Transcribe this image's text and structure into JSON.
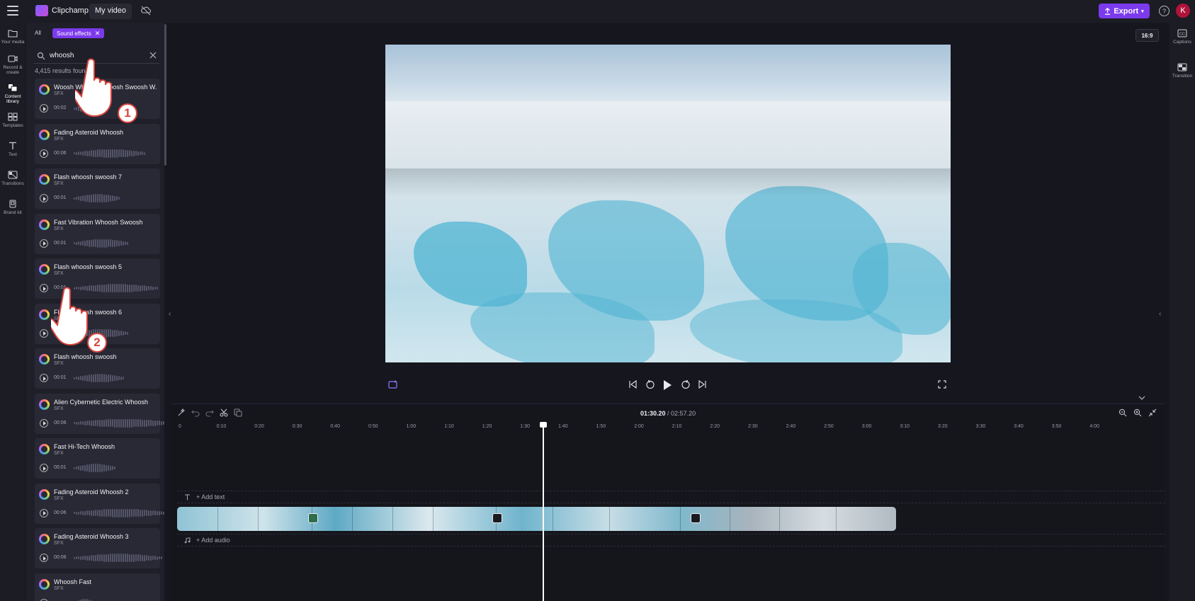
{
  "app": {
    "brand": "Clipchamp",
    "project_name": "My video",
    "export_label": "Export",
    "avatar_initial": "K",
    "accent_color": "#7c3aed"
  },
  "rail": {
    "items": [
      {
        "label": "Your media",
        "icon": "folder-icon"
      },
      {
        "label": "Record & create",
        "icon": "camera-icon"
      },
      {
        "label": "Content library",
        "icon": "library-icon"
      },
      {
        "label": "Templates",
        "icon": "templates-icon"
      },
      {
        "label": "Text",
        "icon": "text-icon"
      },
      {
        "label": "Transitions",
        "icon": "transitions-icon"
      },
      {
        "label": "Brand kit",
        "icon": "brand-kit-icon"
      }
    ]
  },
  "panel": {
    "filter_all": "All",
    "filter_active": "Sound effects",
    "search_value": "whoosh",
    "results_text": "4,415 results found",
    "items": [
      {
        "title": "Woosh Whoosh Swoosh Swoosh W...",
        "type": "SFX",
        "duration": "00:02"
      },
      {
        "title": "Fading Asteroid Whoosh",
        "type": "SFX",
        "duration": "00:06"
      },
      {
        "title": "Flash whoosh swoosh 7",
        "type": "SFX",
        "duration": "00:01"
      },
      {
        "title": "Fast Vibration Whoosh Swoosh",
        "type": "SFX",
        "duration": "00:01"
      },
      {
        "title": "Flash whoosh swoosh 5",
        "type": "SFX",
        "duration": "00:01"
      },
      {
        "title": "Flash whoosh swoosh 6",
        "type": "SFX",
        "duration": "00:01"
      },
      {
        "title": "Flash whoosh swoosh",
        "type": "SFX",
        "duration": "00:01"
      },
      {
        "title": "Alien Cybernetic Electric Whoosh",
        "type": "SFX",
        "duration": "00:06"
      },
      {
        "title": "Fast Hi-Tech Whoosh",
        "type": "SFX",
        "duration": "00:01"
      },
      {
        "title": "Fading Asteroid Whoosh 2",
        "type": "SFX",
        "duration": "00:06"
      },
      {
        "title": "Fading Asteroid Whoosh 3",
        "type": "SFX",
        "duration": "00:06"
      },
      {
        "title": "Whoosh Fast",
        "type": "SFX",
        "duration": ""
      }
    ]
  },
  "right_rail": {
    "captions_label": "Captions",
    "transition_label": "Transition"
  },
  "preview": {
    "aspect_ratio": "16:9"
  },
  "timeline": {
    "current_time": "01:30.20",
    "total_time": "02:57.20",
    "separator": " / ",
    "ruler": [
      "0",
      "0:10",
      "0:20",
      "0:30",
      "0:40",
      "0:50",
      "1:00",
      "1:10",
      "1:20",
      "1:30",
      "1:40",
      "1:50",
      "2:00",
      "2:10",
      "2:20",
      "2:30",
      "2:40",
      "2:50",
      "3:00",
      "3:10",
      "3:20",
      "3:30",
      "3:40",
      "3:50",
      "4:00"
    ],
    "add_text_label": "+ Add text",
    "add_audio_label": "+ Add audio"
  },
  "annotations": {
    "step1": "1",
    "step2": "2"
  }
}
